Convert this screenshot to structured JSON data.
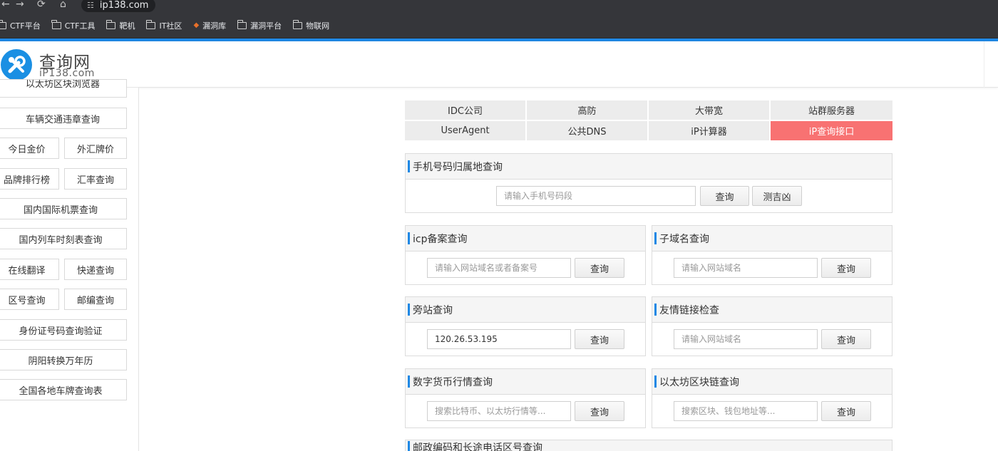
{
  "browser": {
    "url": "ip138.com",
    "bookmarks": [
      "CTF平台",
      "CTF工具",
      "靶机",
      "IT社区",
      "漏洞库",
      "漏洞平台",
      "物联网"
    ]
  },
  "header": {
    "logo_title": "查询网",
    "logo_sub": "iP138.com"
  },
  "sidebar": {
    "items": [
      "以太坊区块浏览器",
      "车辆交通违章查询",
      "今日金价",
      "外汇牌价",
      "品牌排行榜",
      "汇率查询",
      "国内国际机票查询",
      "国内列车时刻表查询",
      "在线翻译",
      "快递查询",
      "区号查询",
      "邮编查询",
      "身份证号码查询验证",
      "阴阳转换万年历",
      "全国各地车牌查询表"
    ]
  },
  "tabs": [
    "IDC公司",
    "高防",
    "大带宽",
    "站群服务器",
    "UserAgent",
    "公共DNS",
    "iP计算器",
    "iP查询接口"
  ],
  "phone": {
    "title": "手机号码归属地查询",
    "placeholder": "请输入手机号码段",
    "query": "查询",
    "fortune": "测吉凶"
  },
  "panels": [
    {
      "title": "icp备案查询",
      "placeholder": "请输入网站域名或者备案号",
      "value": "",
      "button": "查询"
    },
    {
      "title": "子域名查询",
      "placeholder": "请输入网站域名",
      "value": "",
      "button": "查询"
    },
    {
      "title": "旁站查询",
      "placeholder": "",
      "value": "120.26.53.195",
      "button": "查询"
    },
    {
      "title": "友情链接检查",
      "placeholder": "请输入网站域名",
      "value": "",
      "button": "查询"
    },
    {
      "title": "数字货币行情查询",
      "placeholder": "搜索比特币、以太坊行情等...",
      "value": "",
      "button": "查询"
    },
    {
      "title": "以太坊区块链查询",
      "placeholder": "搜索区块、钱包地址等...",
      "value": "",
      "button": "查询"
    }
  ],
  "partial_panel": {
    "title": "邮政编码和长途电话区号查询"
  }
}
